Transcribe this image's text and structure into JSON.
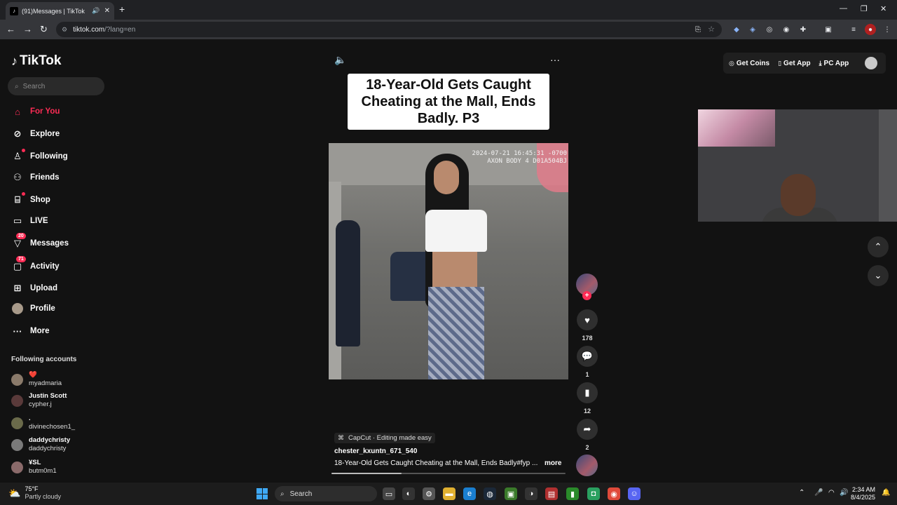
{
  "browser": {
    "tab_title": "(91)Messages | TikTok",
    "tab_favicon": "tiktok-icon",
    "url_domain": "tiktok.com",
    "url_path": "/?lang=en"
  },
  "tiktok": {
    "logo_text": "TikTok",
    "search_placeholder": "Search",
    "nav": [
      {
        "label": "For You",
        "icon": "home-icon",
        "active": true
      },
      {
        "label": "Explore",
        "icon": "compass-icon"
      },
      {
        "label": "Following",
        "icon": "following-icon"
      },
      {
        "label": "Friends",
        "icon": "friends-icon"
      },
      {
        "label": "Shop",
        "icon": "shop-icon"
      },
      {
        "label": "LIVE",
        "icon": "live-icon"
      },
      {
        "label": "Messages",
        "icon": "messages-icon",
        "badge": "20"
      },
      {
        "label": "Activity",
        "icon": "activity-icon",
        "badge": "71"
      },
      {
        "label": "Upload",
        "icon": "upload-icon"
      },
      {
        "label": "Profile",
        "icon": "avatar"
      },
      {
        "label": "More",
        "icon": "more-icon"
      }
    ],
    "following_header": "Following accounts",
    "following": [
      {
        "name": "❤️",
        "handle": "myadmaria"
      },
      {
        "name": "Justin Scott",
        "handle": "cypher.j"
      },
      {
        "name": ".",
        "handle": "divinechosen1_"
      },
      {
        "name": "daddychristy",
        "handle": "daddychristy"
      },
      {
        "name": "¥SL",
        "handle": "butm0m1"
      }
    ],
    "top_actions": {
      "get_coins": "Get Coins",
      "get_app": "Get App",
      "pc_app": "PC App"
    },
    "video": {
      "caption_line1": "18-Year-Old Gets Caught",
      "caption_line2": "Cheating at the Mall, Ends",
      "caption_line3": "Badly. P3",
      "stamp_line1": "2024-07-21 16:45:31 -0700",
      "stamp_line2": "AXON BODY 4 D01A504BJ",
      "likes": "178",
      "comments": "1",
      "saves": "12",
      "shares": "2",
      "capcut_label": "CapCut · Editing made easy",
      "author": "chester_kxuntn_671_540",
      "description": "18-Year-Old Gets Caught Cheating at the Mall, Ends Badly#fyp ...",
      "more_label": "more",
      "progress": 0.3
    }
  },
  "taskbar": {
    "temp": "75°F",
    "weather": "Partly cloudy",
    "search_placeholder": "Search",
    "time": "2:34 AM",
    "date": "8/4/2025"
  },
  "colors": {
    "accent": "#fe2c55",
    "background": "#121212"
  }
}
